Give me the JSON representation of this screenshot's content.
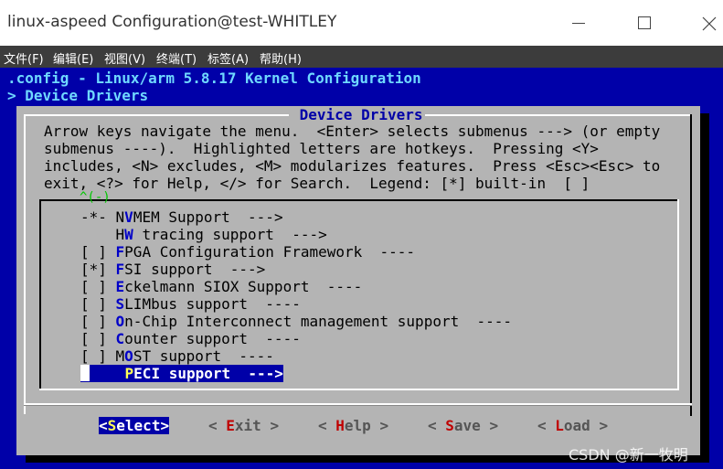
{
  "window": {
    "title": "linux-aspeed Configuration@test-WHITLEY"
  },
  "menubar": {
    "items": [
      "文件(F)",
      "编辑(E)",
      "视图(V)",
      "终端(T)",
      "标签(A)",
      "帮助(H)"
    ]
  },
  "terminal": {
    "line1": ".config - Linux/arm 5.8.17 Kernel Configuration",
    "line2": "> Device Drivers"
  },
  "dialog": {
    "title": " Device Drivers ",
    "help": [
      "Arrow keys navigate the menu.  <Enter> selects submenus ---> (or empty",
      "submenus ----).  Highlighted letters are hotkeys.  Pressing <Y>",
      "includes, <N> excludes, <M> modularizes features.  Press <Esc><Esc> to",
      "exit, <?> for Help, </> for Search.  Legend: [*] built-in  [ ]"
    ],
    "scroll_indicator": "^(-)"
  },
  "menu_items": [
    {
      "mark": "-*- ",
      "pre": "N",
      "hk": "V",
      "rest": "MEM Support  --->"
    },
    {
      "mark": "    ",
      "pre": "H",
      "hk": "W",
      "rest": " tracing support  --->"
    },
    {
      "mark": "[ ] ",
      "pre": "",
      "hk": "F",
      "rest": "PGA Configuration Framework  ----"
    },
    {
      "mark": "[*] ",
      "pre": "",
      "hk": "F",
      "rest": "SI support  --->"
    },
    {
      "mark": "[ ] ",
      "pre": "",
      "hk": "E",
      "rest": "ckelmann SIOX Support  ----"
    },
    {
      "mark": "[ ] ",
      "pre": "",
      "hk": "S",
      "rest": "LIMbus support  ----"
    },
    {
      "mark": "[ ] ",
      "pre": "",
      "hk": "O",
      "rest": "n-Chip Interconnect management support  ----"
    },
    {
      "mark": "[ ] ",
      "pre": "",
      "hk": "C",
      "rest": "ounter support  ----"
    },
    {
      "mark": "[ ] ",
      "pre": "M",
      "hk": "O",
      "rest": "ST support  ----"
    },
    {
      "mark": "    ",
      "pre": "",
      "hk": "P",
      "rest": "ECI support  --->"
    }
  ],
  "buttons": [
    {
      "pre": "<",
      "hk": "S",
      "rest": "elect>"
    },
    {
      "pre": "< ",
      "hk": "E",
      "rest": "xit >"
    },
    {
      "pre": "< ",
      "hk": "H",
      "rest": "elp >"
    },
    {
      "pre": "< ",
      "hk": "S",
      "rest": "ave >"
    },
    {
      "pre": "< ",
      "hk": "L",
      "rest": "oad >"
    }
  ],
  "watermark": "CSDN @新一牧明",
  "colors": {
    "terminal_bg": "#0000a8",
    "dialog_bg": "#b4b4b4",
    "hotkey": "#0000c8",
    "button_hotkey": "#c00000",
    "selected_bg": "#0000a8"
  }
}
